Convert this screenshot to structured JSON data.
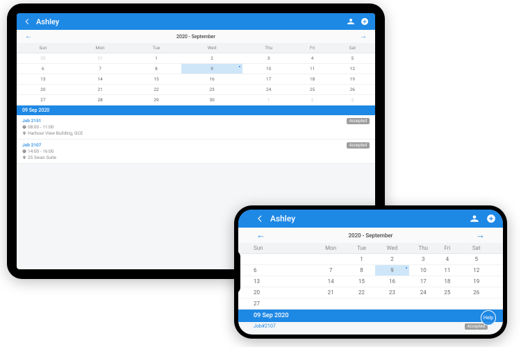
{
  "colors": {
    "primary": "#1e88e5",
    "badge": "#9e9e9e"
  },
  "header": {
    "title": "Ashley"
  },
  "calendar": {
    "label": "2020 - September",
    "days": [
      "Sun",
      "Mon",
      "Tue",
      "Wed",
      "Thu",
      "Fri",
      "Sat"
    ],
    "rows": [
      [
        "30",
        "31",
        "1",
        "2",
        "3",
        "4",
        "5"
      ],
      [
        "6",
        "7",
        "8",
        "9",
        "10",
        "11",
        "12"
      ],
      [
        "13",
        "14",
        "15",
        "16",
        "17",
        "18",
        "19"
      ],
      [
        "20",
        "21",
        "22",
        "23",
        "24",
        "25",
        "26"
      ],
      [
        "27",
        "28",
        "29",
        "30",
        "1",
        "2",
        "3"
      ]
    ],
    "selected": {
      "row": 1,
      "col": 3
    }
  },
  "selected_date_label": "09 Sep 2020",
  "jobs": [
    {
      "id": "Job 2151",
      "time": "08:00 - 11:00",
      "location": "Harbour View Building, GCE",
      "status": "Accepted"
    },
    {
      "id": "Job 2107",
      "time": "14:00 - 16:00",
      "location": "25 Swan Suite",
      "status": "Accepted"
    }
  ],
  "phone": {
    "days_short": [
      "Sun",
      "Mon",
      "Tue",
      "Wed",
      "Thu",
      "Fri",
      "Sat"
    ],
    "rows": [
      [
        "",
        "",
        "1",
        "2",
        "3",
        "4",
        "5"
      ],
      [
        "6",
        "7",
        "8",
        "9",
        "10",
        "11",
        "12"
      ],
      [
        "13",
        "14",
        "15",
        "16",
        "17",
        "18",
        "19"
      ],
      [
        "20",
        "21",
        "22",
        "23",
        "24",
        "25",
        "26"
      ],
      [
        "27",
        "",
        "",
        "",
        "",
        "",
        ""
      ]
    ],
    "selected": {
      "row": 1,
      "col": 3
    },
    "peek_job": "Job#2107",
    "peek_status": "Accepted"
  },
  "help_label": "Help"
}
